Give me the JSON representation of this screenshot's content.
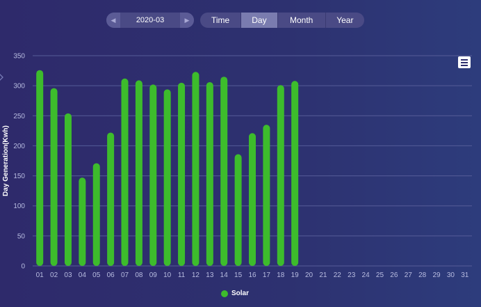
{
  "date_picker": {
    "value": "2020-03",
    "prev_icon": "skip-prev-icon",
    "next_icon": "skip-next-icon"
  },
  "tabs": [
    {
      "label": "Time",
      "active": false
    },
    {
      "label": "Day",
      "active": true
    },
    {
      "label": "Month",
      "active": false
    },
    {
      "label": "Year",
      "active": false
    }
  ],
  "menu_icon": "hamburger-menu-icon",
  "colors": {
    "bar": "#3dbc2c",
    "axis_text": "#b8bce0",
    "grid": "#565c98"
  },
  "chart_data": {
    "type": "bar",
    "ylabel": "Day  Generation(Kwh)",
    "ylim": [
      0,
      350
    ],
    "yticks": [
      "0",
      "50",
      "100",
      "150",
      "200",
      "250",
      "300",
      "350"
    ],
    "categories": [
      "01",
      "02",
      "03",
      "04",
      "05",
      "06",
      "07",
      "08",
      "09",
      "10",
      "11",
      "12",
      "13",
      "14",
      "15",
      "16",
      "17",
      "18",
      "19",
      "20",
      "21",
      "22",
      "23",
      "24",
      "25",
      "26",
      "27",
      "28",
      "29",
      "30",
      "31"
    ],
    "series": [
      {
        "name": "Solar",
        "values": [
          326,
          296,
          254,
          147,
          171,
          222,
          312,
          309,
          302,
          294,
          305,
          323,
          306,
          315,
          186,
          221,
          235,
          301,
          308,
          null,
          null,
          null,
          null,
          null,
          null,
          null,
          null,
          null,
          null,
          null,
          null
        ]
      }
    ],
    "grid": true,
    "legend": "bottom-center"
  }
}
